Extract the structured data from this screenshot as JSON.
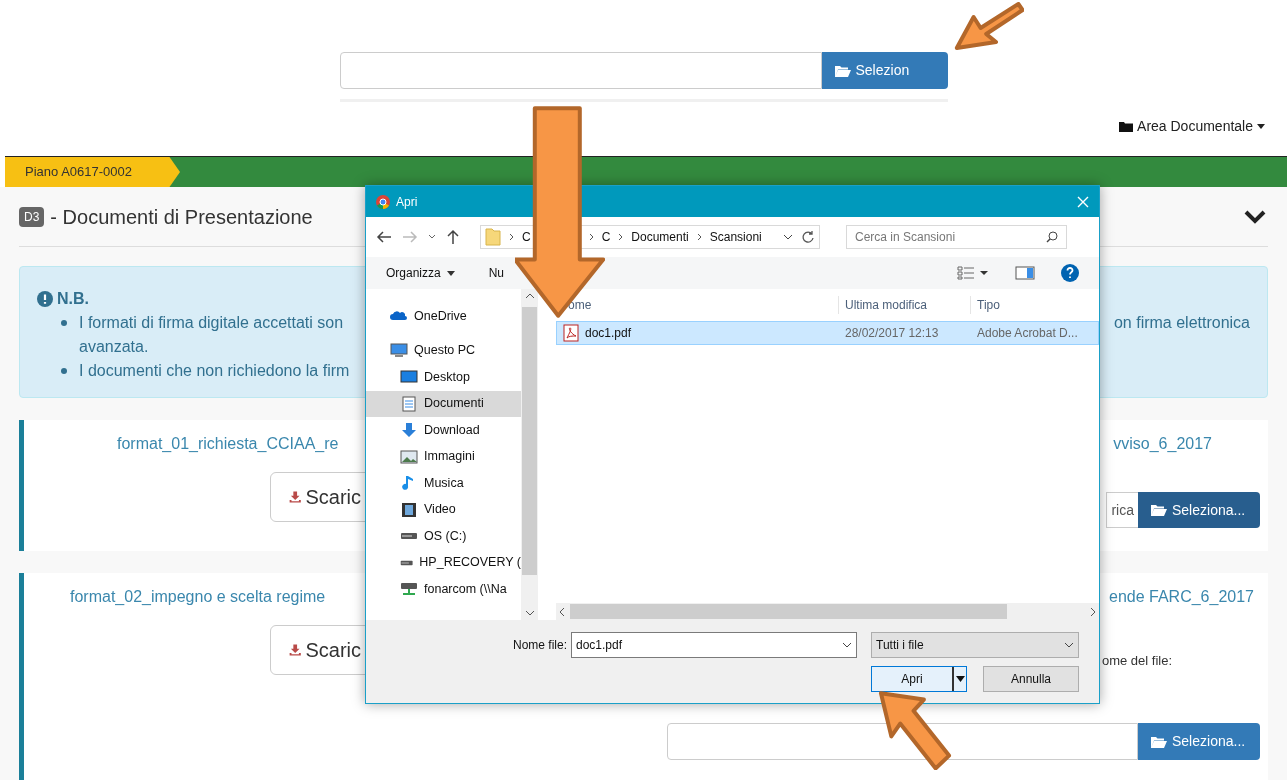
{
  "top_upload": {
    "button": "Selezion"
  },
  "menu": {
    "label": "Area Documentale"
  },
  "breadcrumb": {
    "label": "Piano A0617-0002"
  },
  "section": {
    "badge": "D3",
    "title": "- Documenti di Presentazione"
  },
  "notice": {
    "title": "N.B.",
    "lines": [
      {
        "kind": "bullet",
        "left": "I formati di firma digitale accettati son",
        "right": "on firma elettronica"
      },
      {
        "kind": "continuation",
        "left": "avanzata."
      },
      {
        "kind": "bullet",
        "left": "I documenti che non richiedono la firm"
      }
    ]
  },
  "documents": [
    {
      "title_left": "format_01_richiesta_CCIAA_re",
      "title_right": "vviso_6_2017",
      "download_button": "Scaric",
      "field_text": "rica",
      "select_button": "Seleziona...",
      "pressed": true
    },
    {
      "title_left": "format_02_impegno e scelta regime",
      "title_right": "ende FARC_6_2017",
      "download_button": "Scaric",
      "hint": "ome del file:",
      "select_button": "Seleziona...",
      "pressed": false
    }
  ],
  "dialog": {
    "title": "Apri",
    "path": [
      "C",
      "C",
      "Documenti",
      "Scansioni"
    ],
    "search": {
      "placeholder": "Cerca in Scansioni"
    },
    "toolbar": [
      "Organizza",
      "Nu"
    ],
    "nav_pane": [
      {
        "label": "OneDrive",
        "kind": "cloud",
        "selected": false
      },
      {
        "label": "Questo PC",
        "kind": "computer",
        "selected": false,
        "children": [
          {
            "label": "Desktop",
            "kind": "desktop",
            "selected": false
          },
          {
            "label": "Documenti",
            "kind": "documents",
            "selected": true
          },
          {
            "label": "Download",
            "kind": "downloads",
            "selected": false
          },
          {
            "label": "Immagini",
            "kind": "pictures",
            "selected": false
          },
          {
            "label": "Musica",
            "kind": "music",
            "selected": false
          },
          {
            "label": "Video",
            "kind": "videos",
            "selected": false
          },
          {
            "label": "OS (C:)",
            "kind": "drive",
            "selected": false
          },
          {
            "label": "HP_RECOVERY (",
            "kind": "drive",
            "selected": false
          },
          {
            "label": "fonarcom (\\\\Na",
            "kind": "network",
            "selected": false
          }
        ]
      }
    ],
    "columns": [
      "ome",
      "Ultima modifica",
      "Tipo"
    ],
    "files": [
      {
        "name": "doc1.pdf",
        "modified": "28/02/2017 12:13",
        "type": "Adobe Acrobat D...",
        "selected": true
      }
    ],
    "filename_label": "Nome file:",
    "filename_value": "doc1.pdf",
    "filter": "Tutti i file",
    "buttons": [
      "Apri",
      "Annulla"
    ]
  }
}
